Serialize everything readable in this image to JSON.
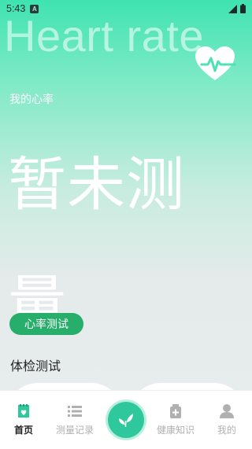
{
  "status_bar": {
    "time": "5:43",
    "notification_glyph": "A"
  },
  "header": {
    "background_title": "Heart rate",
    "icon": "heart-pulse-icon"
  },
  "heart_rate": {
    "label": "我的心率",
    "value_text": "暂未测量",
    "measure_button": "心率测试"
  },
  "fitness": {
    "heading": "体检测试"
  },
  "nav": {
    "items": [
      {
        "label": "首页",
        "icon": "home-icon",
        "active": true
      },
      {
        "label": "测量记录",
        "icon": "list-icon",
        "active": false
      },
      {
        "label": "",
        "icon": "leaf-icon",
        "active": false
      },
      {
        "label": "健康知识",
        "icon": "medicine-box-icon",
        "active": false
      },
      {
        "label": "我的",
        "icon": "person-icon",
        "active": false
      }
    ]
  },
  "colors": {
    "accent": "#27ae6b",
    "gradient_top": "#3fe3b0",
    "center_button": "#2fc79c",
    "active_nav": "#222222",
    "inactive_nav": "#b0b0b0"
  }
}
